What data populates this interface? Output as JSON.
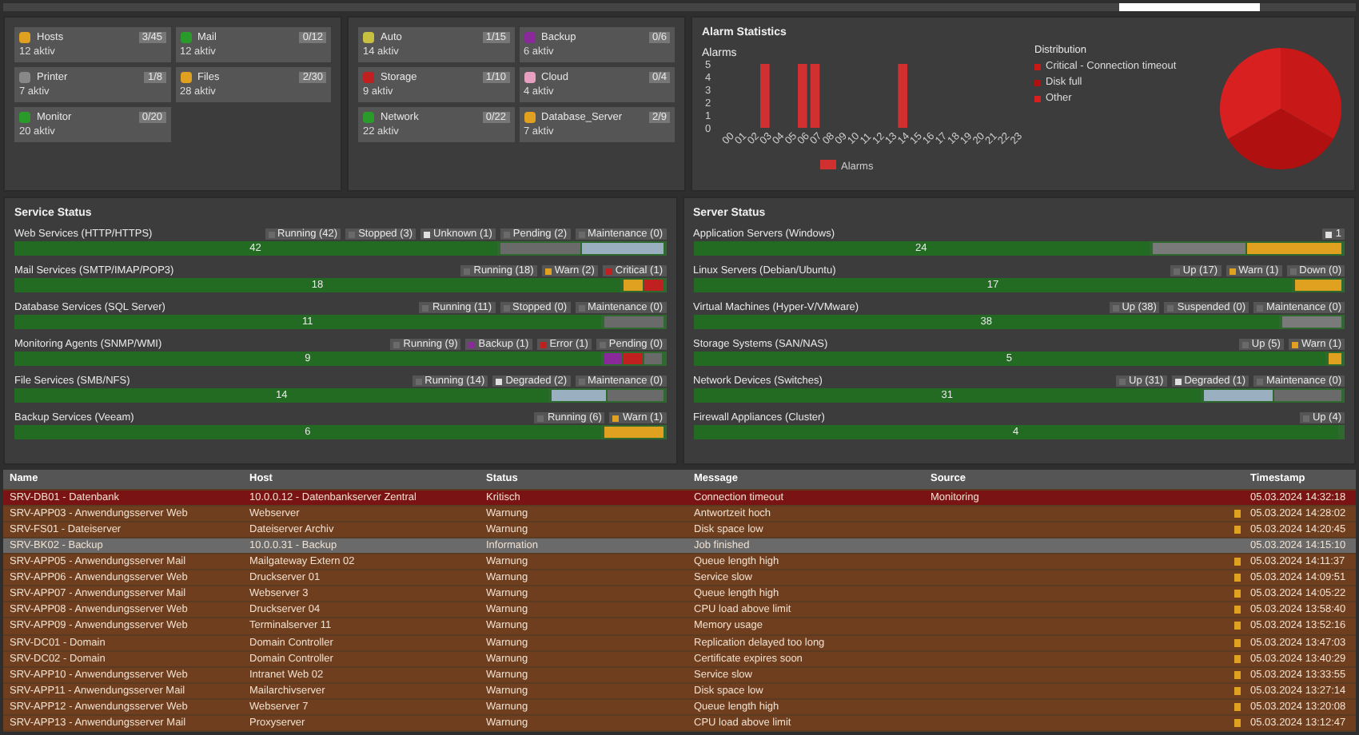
{
  "tile_groups": [
    {
      "tiles": [
        {
          "name": "Hosts",
          "count": "3/45",
          "sub": "12 aktiv",
          "color": "#e0a020"
        },
        {
          "name": "Mail",
          "count": "0/12",
          "sub": "12 aktiv",
          "color": "#2a9a2a"
        },
        {
          "name": "Printer",
          "count": "1/8",
          "sub": "7 aktiv",
          "color": "#888888"
        },
        {
          "name": "Files",
          "count": "2/30",
          "sub": "28 aktiv",
          "color": "#e0a020"
        },
        {
          "name": "Monitor",
          "count": "0/20",
          "sub": "20 aktiv",
          "color": "#2a9a2a"
        }
      ]
    },
    {
      "tiles": [
        {
          "name": "Auto",
          "count": "1/15",
          "sub": "14 aktiv",
          "color": "#c8c040"
        },
        {
          "name": "Backup",
          "count": "0/6",
          "sub": "6 aktiv",
          "color": "#8a2a9a"
        },
        {
          "name": "Storage",
          "count": "1/10",
          "sub": "9 aktiv",
          "color": "#c02020"
        },
        {
          "name": "Cloud",
          "count": "0/4",
          "sub": "4 aktiv",
          "color": "#e8a0c0"
        },
        {
          "name": "Network",
          "count": "0/22",
          "sub": "22 aktiv",
          "color": "#2a9a2a"
        },
        {
          "name": "Database_Server",
          "count": "2/9",
          "sub": "7 aktiv",
          "color": "#e0a020"
        }
      ]
    }
  ],
  "statistics": {
    "title": "Alarm Statistics",
    "chart_data": {
      "type": "bar",
      "title": "Alarms",
      "categories": [
        "00",
        "01",
        "02",
        "03",
        "04",
        "05",
        "06",
        "07",
        "08",
        "09",
        "10",
        "11",
        "12",
        "13",
        "14",
        "15",
        "16",
        "17",
        "18",
        "19",
        "20",
        "21",
        "22",
        "23"
      ],
      "yticks": [
        0,
        1,
        2,
        3,
        4,
        5
      ],
      "ylim": [
        0,
        5
      ],
      "series": [
        {
          "name": "Alarms",
          "color": "#d03030",
          "values": [
            0,
            0,
            0,
            5,
            0,
            0,
            5,
            5,
            0,
            0,
            0,
            0,
            0,
            0,
            5,
            0,
            0,
            0,
            0,
            0,
            0,
            0,
            0,
            0
          ]
        }
      ]
    },
    "pie": {
      "title": "Distribution",
      "legend": [
        {
          "label": "Critical - Connection timeout",
          "color": "#c81818"
        },
        {
          "label": "Disk full",
          "color": "#b01010"
        },
        {
          "label": "Other",
          "color": "#d82020"
        }
      ]
    }
  },
  "service_panels": [
    {
      "title": "Service Status",
      "rows": [
        {
          "label": "Web Services (HTTP/HTTPS)",
          "tags": [
            {
              "text": "Running (42)",
              "color": "#6a6a6a"
            },
            {
              "text": "Stopped (3)",
              "color": "#6a6a6a"
            },
            {
              "text": "Unknown (1)",
              "color": "#e0e0e0"
            },
            {
              "text": "Pending (2)",
              "color": "#6a6a6a"
            },
            {
              "text": "Maintenance (0)",
              "color": "#6a6a6a"
            }
          ],
          "level": 0.74,
          "value": "42",
          "segments": [
            {
              "color": "#6a6a6a"
            },
            {
              "color": "#9ab0c0"
            }
          ]
        },
        {
          "label": "Mail Services (SMTP/IMAP/POP3)",
          "tags": [
            {
              "text": "Running (18)",
              "color": "#6a6a6a"
            },
            {
              "text": "Warn (2)",
              "color": "#e0a020"
            },
            {
              "text": "Critical (1)",
              "color": "#c02020"
            }
          ],
          "level": 0.93,
          "value": "18",
          "segments": [
            {
              "color": "#e0a020"
            },
            {
              "color": "#c02020"
            }
          ]
        },
        {
          "label": "Database Services (SQL Server)",
          "tags": [
            {
              "text": "Running (11)",
              "color": "#6a6a6a"
            },
            {
              "text": "Stopped (0)",
              "color": "#6a6a6a"
            },
            {
              "text": "Maintenance (0)",
              "color": "#6a6a6a"
            }
          ],
          "level": 0.9,
          "value": "11",
          "segments": [
            {
              "color": "#6a6a6a"
            }
          ]
        },
        {
          "label": "Monitoring Agents (SNMP/WMI)",
          "tags": [
            {
              "text": "Running (9)",
              "color": "#6a6a6a"
            },
            {
              "text": "Backup (1)",
              "color": "#8a2a9a"
            },
            {
              "text": "Error (1)",
              "color": "#c02020"
            },
            {
              "text": "Pending (0)",
              "color": "#6a6a6a"
            }
          ],
          "level": 0.9,
          "value": "9",
          "segments": [
            {
              "color": "#8a2a9a"
            },
            {
              "color": "#c02020"
            },
            {
              "color": "#6a6a6a"
            }
          ]
        },
        {
          "label": "File Services (SMB/NFS)",
          "tags": [
            {
              "text": "Running (14)",
              "color": "#6a6a6a"
            },
            {
              "text": "Degraded (2)",
              "color": "#e0e0e0"
            },
            {
              "text": "Maintenance (0)",
              "color": "#6a6a6a"
            }
          ],
          "level": 0.82,
          "value": "14",
          "segments": [
            {
              "color": "#9ab0c0"
            },
            {
              "color": "#6a6a6a"
            }
          ]
        },
        {
          "label": "Backup Services (Veeam)",
          "tags": [
            {
              "text": "Running (6)",
              "color": "#6a6a6a"
            },
            {
              "text": "Warn (1)",
              "color": "#e0a020"
            }
          ],
          "level": 0.9,
          "value": "6",
          "segments": [
            {
              "color": "#e0a020"
            }
          ]
        }
      ]
    },
    {
      "title": "Server Status",
      "rows": [
        {
          "label": "Application Servers (Windows)",
          "tags": [
            {
              "text": "1",
              "color": "#e0e0e0"
            }
          ],
          "level": 0.7,
          "value": "24",
          "segments": [
            {
              "color": "#7a7a7a"
            },
            {
              "color": "#e0a020"
            }
          ]
        },
        {
          "label": "Linux Servers (Debian/Ubuntu)",
          "tags": [
            {
              "text": "Up (17)",
              "color": "#6a6a6a"
            },
            {
              "text": "Warn (1)",
              "color": "#e0a020"
            },
            {
              "text": "Down (0)",
              "color": "#6a6a6a"
            }
          ],
          "level": 0.92,
          "value": "17",
          "segments": [
            {
              "color": "#e0a020"
            }
          ]
        },
        {
          "label": "Virtual Machines (Hyper-V/VMware)",
          "tags": [
            {
              "text": "Up (38)",
              "color": "#6a6a6a"
            },
            {
              "text": "Suspended (0)",
              "color": "#6a6a6a"
            },
            {
              "text": "Maintenance (0)",
              "color": "#6a6a6a"
            }
          ],
          "level": 0.9,
          "value": "38",
          "segments": [
            {
              "color": "#7a7a7a"
            }
          ]
        },
        {
          "label": "Storage Systems (SAN/NAS)",
          "tags": [
            {
              "text": "Up (5)",
              "color": "#6a6a6a"
            },
            {
              "text": "Warn (1)",
              "color": "#e0a020"
            }
          ],
          "level": 0.97,
          "value": "5",
          "segments": [
            {
              "color": "#e0a020"
            }
          ]
        },
        {
          "label": "Network Devices (Switches)",
          "tags": [
            {
              "text": "Up (31)",
              "color": "#6a6a6a"
            },
            {
              "text": "Degraded (1)",
              "color": "#e0e0e0"
            },
            {
              "text": "Maintenance (0)",
              "color": "#6a6a6a"
            }
          ],
          "level": 0.78,
          "value": "31",
          "segments": [
            {
              "color": "#9ab0c0"
            },
            {
              "color": "#6a6a6a"
            }
          ]
        },
        {
          "label": "Firewall Appliances (Cluster)",
          "tags": [
            {
              "text": "Up (4)",
              "color": "#6a6a6a"
            }
          ],
          "level": 1,
          "value": "4",
          "segments": []
        }
      ]
    }
  ],
  "alarm_table": {
    "columns": [
      "Name",
      "Host",
      "Status",
      "Message",
      "Source",
      "Timestamp"
    ],
    "rows": [
      {
        "kind": "critical",
        "cells": [
          "SRV-DB01 - Datenbank",
          "10.0.0.12 - Datenbankserver Zentral",
          "Kritisch",
          "Connection timeout",
          "Monitoring",
          "05.03.2024 14:32:18"
        ]
      },
      {
        "kind": "warning",
        "cells": [
          "SRV-APP03 - Anwendungsserver Web",
          "Webserver",
          "Warnung",
          "Antwortzeit hoch",
          "",
          "05.03.2024 14:28:02"
        ]
      },
      {
        "kind": "warning",
        "cells": [
          "SRV-FS01 - Dateiserver",
          "Dateiserver Archiv",
          "Warnung",
          "Disk space low",
          "",
          "05.03.2024 14:20:45"
        ]
      },
      {
        "kind": "info",
        "cells": [
          "SRV-BK02 - Backup",
          "10.0.0.31 - Backup",
          "Information",
          "Job finished",
          "",
          "05.03.2024 14:15:10"
        ]
      },
      {
        "kind": "warning",
        "cells": [
          "SRV-APP05 - Anwendungsserver Mail",
          "Mailgateway Extern 02",
          "Warnung",
          "Queue length high",
          "",
          "05.03.2024 14:11:37"
        ]
      },
      {
        "kind": "warning",
        "cells": [
          "SRV-APP06 - Anwendungsserver Web",
          "Druckserver 01",
          "Warnung",
          "Service slow",
          "",
          "05.03.2024 14:09:51"
        ]
      },
      {
        "kind": "warning",
        "cells": [
          "SRV-APP07 - Anwendungsserver Mail",
          "Webserver 3",
          "Warnung",
          "Queue length high",
          "",
          "05.03.2024 14:05:22"
        ]
      },
      {
        "kind": "warning",
        "cells": [
          "SRV-APP08 - Anwendungsserver Web",
          "Druckserver 04",
          "Warnung",
          "CPU load above limit",
          "",
          "05.03.2024 13:58:40"
        ]
      },
      {
        "kind": "warning",
        "cells": [
          "SRV-APP09 - Anwendungsserver Web",
          "Terminalserver 11",
          "Warnung",
          "Memory usage",
          "",
          "05.03.2024 13:52:16"
        ]
      },
      {
        "kind": "warning",
        "cells": [
          "SRV-DC01 - Domain",
          "Domain Controller",
          "Warnung",
          "Replication delayed too long",
          "",
          "05.03.2024 13:47:03"
        ]
      },
      {
        "kind": "warning",
        "cells": [
          "SRV-DC02 - Domain",
          "Domain Controller",
          "Warnung",
          "Certificate expires soon",
          "",
          "05.03.2024 13:40:29"
        ]
      },
      {
        "kind": "warning",
        "cells": [
          "SRV-APP10 - Anwendungsserver Web",
          "Intranet Web 02",
          "Warnung",
          "Service slow",
          "",
          "05.03.2024 13:33:55"
        ]
      },
      {
        "kind": "warning",
        "cells": [
          "SRV-APP11 - Anwendungsserver Mail",
          "Mailarchivserver",
          "Warnung",
          "Disk space low",
          "",
          "05.03.2024 13:27:14"
        ]
      },
      {
        "kind": "warning",
        "cells": [
          "SRV-APP12 - Anwendungsserver Web",
          "Webserver 7",
          "Warnung",
          "Queue length high",
          "",
          "05.03.2024 13:20:08"
        ]
      },
      {
        "kind": "warning",
        "cells": [
          "SRV-APP13 - Anwendungsserver Mail",
          "Proxyserver",
          "Warnung",
          "CPU load above limit",
          "",
          "05.03.2024 13:12:47"
        ]
      }
    ]
  }
}
